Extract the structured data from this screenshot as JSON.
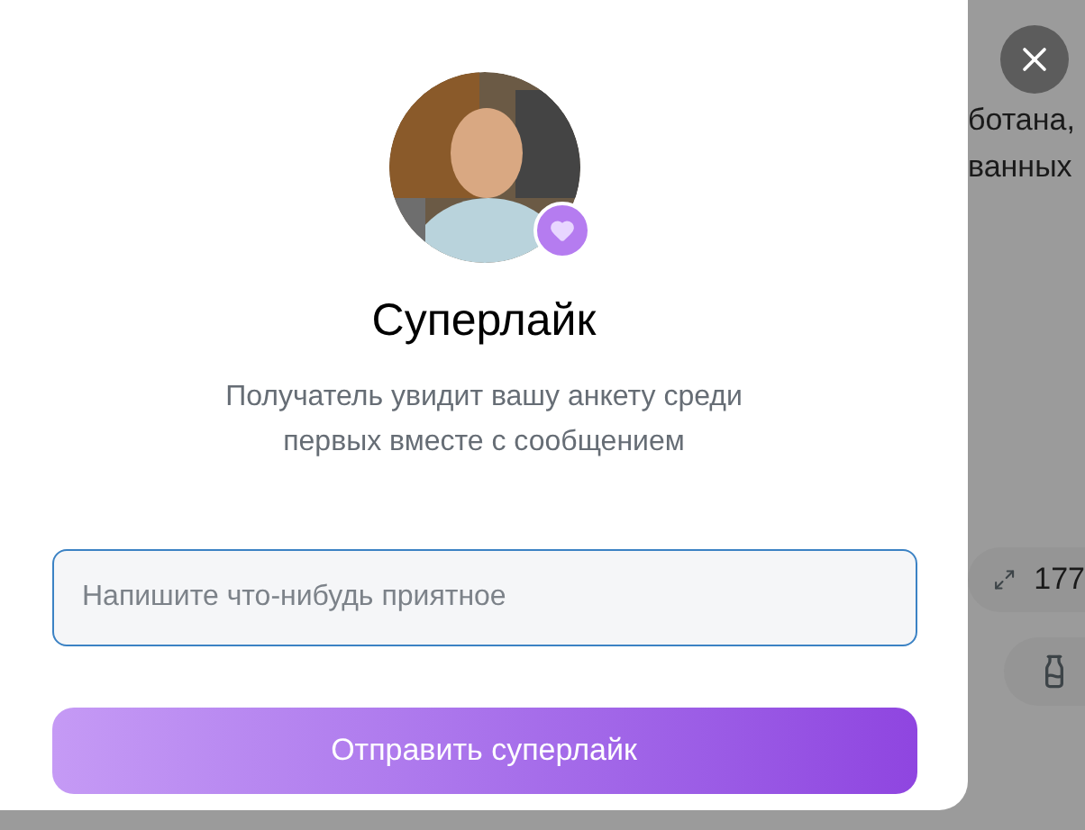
{
  "background": {
    "lines": [
      "ботана,",
      "ванных"
    ],
    "chips": [
      {
        "kind": "size",
        "label": "177"
      },
      {
        "kind": "bottle"
      }
    ]
  },
  "modal": {
    "title": "Суперлайк",
    "subtitle": "Получатель увидит вашу анкету среди первых вместе с сообщением",
    "message": {
      "placeholder": "Напишите что-нибудь приятное"
    },
    "send_button": "Отправить суперлайк"
  }
}
